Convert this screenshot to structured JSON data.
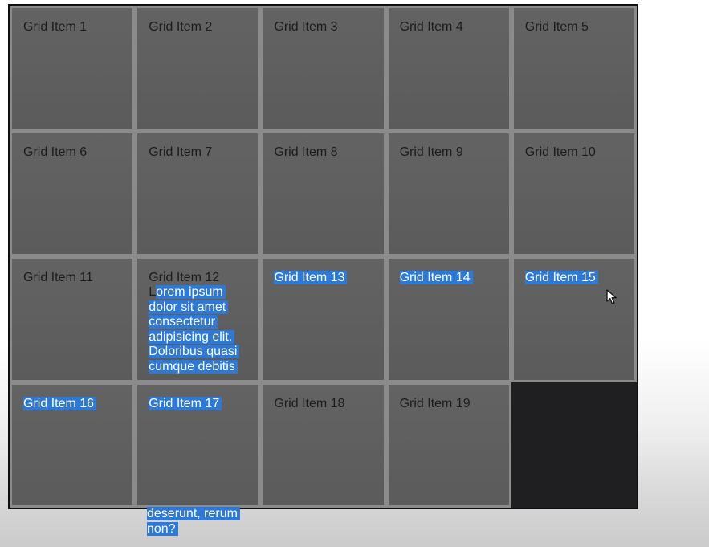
{
  "grid": {
    "items": [
      {
        "title": "Grid Item 1",
        "selected": false
      },
      {
        "title": "Grid Item 2",
        "selected": false
      },
      {
        "title": "Grid Item 3",
        "selected": false
      },
      {
        "title": "Grid Item 4",
        "selected": false
      },
      {
        "title": "Grid Item 5",
        "selected": false
      },
      {
        "title": "Grid Item 6",
        "selected": false
      },
      {
        "title": "Grid Item 7",
        "selected": false
      },
      {
        "title": "Grid Item 8",
        "selected": false
      },
      {
        "title": "Grid Item 9",
        "selected": false
      },
      {
        "title": "Grid Item 10",
        "selected": false
      },
      {
        "title": "Grid Item 11",
        "selected": false
      },
      {
        "title": "Grid Item 12",
        "selected": false,
        "body_lead": "L",
        "body_selected": "orem ipsum dolor sit amet consectetur adipisicing elit. Doloribus quasi cumque debitis distinctio dolores"
      },
      {
        "title": "Grid Item 13",
        "selected": true
      },
      {
        "title": "Grid Item 14",
        "selected": true
      },
      {
        "title": "Grid Item 15",
        "selected": true
      },
      {
        "title": "Grid Item 16",
        "selected": true
      },
      {
        "title": "Grid Item 17",
        "selected": true
      },
      {
        "title": "Grid Item 18",
        "selected": false
      },
      {
        "title": "Grid Item 19",
        "selected": false
      }
    ],
    "overflow_text": "deserunt, rerum non?"
  },
  "colors": {
    "item_background": "#5f5f5f",
    "item_border": "#8b8b8b",
    "container_background": "#1f1f21",
    "selection": "#2e78d6"
  },
  "icons": {
    "cursor": "mouse-pointer-icon"
  }
}
